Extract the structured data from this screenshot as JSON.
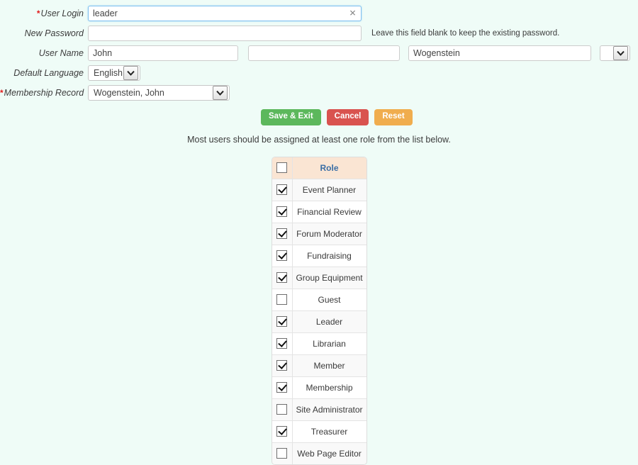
{
  "form": {
    "rows": {
      "user_login": {
        "label": "User Login",
        "required": true,
        "value": "leader",
        "placeholder": "",
        "clear_icon": "close-icon"
      },
      "new_password": {
        "label": "New Password",
        "required": false,
        "value": "",
        "placeholder": "",
        "hint": "Leave this field blank to keep the existing password."
      },
      "user_name": {
        "label": "User Name",
        "required": false,
        "first": "John",
        "middle": "",
        "last": "Wogenstein",
        "suffix": ""
      },
      "default_language": {
        "label": "Default Language",
        "required": false,
        "value": "English"
      },
      "membership_record": {
        "label": "Membership Record",
        "required": true,
        "value": "Wogenstein, John"
      }
    }
  },
  "buttons": {
    "save": "Save & Exit",
    "cancel": "Cancel",
    "reset": "Reset"
  },
  "note": "Most users should be assigned at least one role from the list below.",
  "roles_table": {
    "header": {
      "select_all_checked": false,
      "role_column": "Role"
    },
    "rows": [
      {
        "name": "Event Planner",
        "checked": true
      },
      {
        "name": "Financial Review",
        "checked": true
      },
      {
        "name": "Forum Moderator",
        "checked": true
      },
      {
        "name": "Fundraising",
        "checked": true
      },
      {
        "name": "Group Equipment",
        "checked": true
      },
      {
        "name": "Guest",
        "checked": false
      },
      {
        "name": "Leader",
        "checked": true
      },
      {
        "name": "Librarian",
        "checked": true
      },
      {
        "name": "Member",
        "checked": true
      },
      {
        "name": "Membership",
        "checked": true
      },
      {
        "name": "Site Administrator",
        "checked": false
      },
      {
        "name": "Treasurer",
        "checked": true
      },
      {
        "name": "Web Page Editor",
        "checked": false
      }
    ]
  },
  "colors": {
    "page_background": "#effcf7",
    "save_button": "#5cb85c",
    "cancel_button": "#d9534f",
    "reset_button": "#f0ad4e",
    "table_header_background": "#fae5d3",
    "table_header_text": "#3a6ea5",
    "required_marker": "#e11b1b",
    "focus_border": "#7ec0f0"
  }
}
